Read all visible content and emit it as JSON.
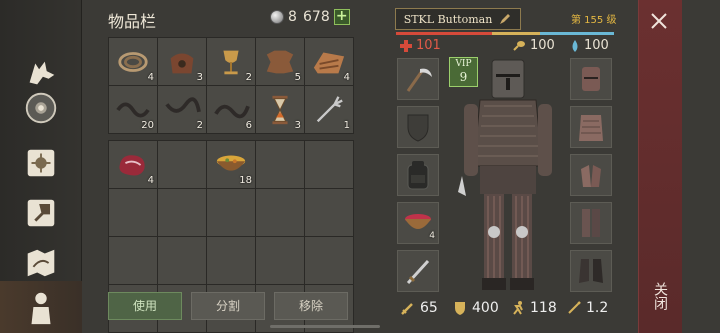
{
  "inventory": {
    "title": "物品栏",
    "silver": "8",
    "gold": "678",
    "plus": "+",
    "items": [
      {
        "icon": "rope-icon",
        "qty": "4"
      },
      {
        "icon": "bag-icon",
        "qty": "3"
      },
      {
        "icon": "goblet-icon",
        "qty": "2"
      },
      {
        "icon": "hide-icon",
        "qty": "5"
      },
      {
        "icon": "fur-pile-icon",
        "qty": "4"
      },
      {
        "icon": "chain-icon",
        "qty": "20"
      },
      {
        "icon": "chain-icon",
        "qty": "2"
      },
      {
        "icon": "chain-icon",
        "qty": "6"
      },
      {
        "icon": "hourglass-icon",
        "qty": "3"
      },
      {
        "icon": "fork-icon",
        "qty": "1"
      }
    ],
    "bag_items": [
      {
        "icon": "raw-meat-icon",
        "qty": "4"
      },
      {
        "icon": "soup-bowl-icon",
        "qty": "18"
      }
    ],
    "buttons": {
      "use": "使用",
      "split": "分割",
      "remove": "移除"
    }
  },
  "character": {
    "name": "STKL Buttoman",
    "level": "第 155 级",
    "health": "101",
    "hunger": "100",
    "thirst": "100",
    "vip_label": "VIP",
    "vip_level": "9",
    "bag_qty": "4",
    "stats": {
      "damage": "65",
      "armor": "400",
      "speed": "118",
      "weight": "1.2"
    },
    "colors": {
      "health": "#d64a3a",
      "hunger": "#d6b25a",
      "thirst": "#6ab8d6",
      "level": "#e5b842"
    }
  },
  "close": {
    "label": "关闭"
  }
}
